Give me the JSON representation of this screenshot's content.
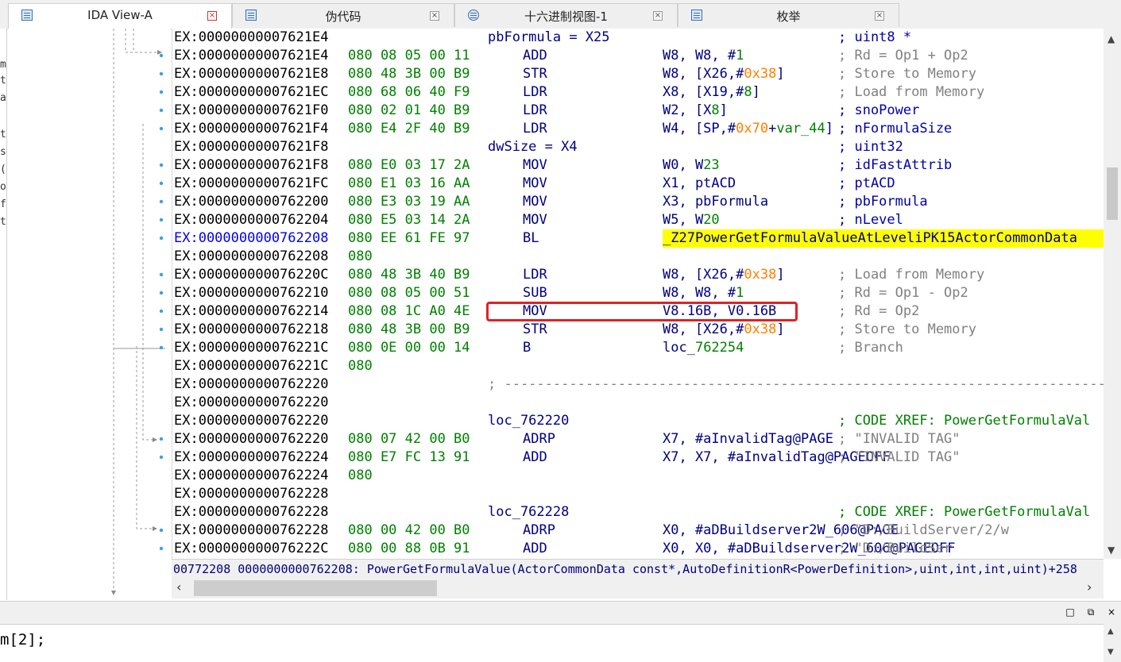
{
  "tabs": [
    {
      "label": "IDA View-A",
      "active": true
    },
    {
      "label": "伪代码",
      "active": false
    },
    {
      "label": "十六进制视图-1",
      "active": false
    },
    {
      "label": "枚举",
      "active": false
    }
  ],
  "left_panel_chars": [
    "m",
    "t",
    "a",
    "t",
    "s",
    "(",
    "o",
    "f",
    "t"
  ],
  "listing": [
    {
      "addr": "EX:00000000007621E4",
      "bytes": "",
      "mn": "pbFormula = X25",
      "op": "",
      "comment": "; uint8 *",
      "kind": "var"
    },
    {
      "addr": "EX:00000000007621E4",
      "bytes": "080 08 05 00 11",
      "mn": "ADD",
      "op": "W8, W8, #1",
      "comment": "; Rd = Op1 + Op2",
      "kind": "insn"
    },
    {
      "addr": "EX:00000000007621E8",
      "bytes": "080 48 3B 00 B9",
      "mn": "STR",
      "op": "W8, [X26,#0x38]",
      "comment": "; Store to Memory",
      "kind": "insn"
    },
    {
      "addr": "EX:00000000007621EC",
      "bytes": "080 68 06 40 F9",
      "mn": "LDR",
      "op": "X8, [X19,#8]",
      "comment": "; Load from Memory",
      "kind": "insn"
    },
    {
      "addr": "EX:00000000007621F0",
      "bytes": "080 02 01 40 B9",
      "mn": "LDR",
      "op": "W2, [X8]",
      "comment": "; snoPower",
      "kind": "insn",
      "nav": true
    },
    {
      "addr": "EX:00000000007621F4",
      "bytes": "080 E4 2F 40 B9",
      "mn": "LDR",
      "op": "W4, [SP,#0x70+var_44]",
      "comment": "; nFormulaSize",
      "kind": "insn",
      "nav": true
    },
    {
      "addr": "EX:00000000007621F8",
      "bytes": "",
      "mn": "dwSize = X4",
      "op": "",
      "comment": "; uint32",
      "kind": "var"
    },
    {
      "addr": "EX:00000000007621F8",
      "bytes": "080 E0 03 17 2A",
      "mn": "MOV",
      "op": "W0, W23",
      "comment": "; idFastAttrib",
      "kind": "insn",
      "nav": true
    },
    {
      "addr": "EX:00000000007621FC",
      "bytes": "080 E1 03 16 AA",
      "mn": "MOV",
      "op": "X1, ptACD",
      "comment": "; ptACD",
      "kind": "insn",
      "nav": true
    },
    {
      "addr": "EX:0000000000762200",
      "bytes": "080 E3 03 19 AA",
      "mn": "MOV",
      "op": "X3, pbFormula",
      "comment": "; pbFormula",
      "kind": "insn",
      "nav": true
    },
    {
      "addr": "EX:0000000000762204",
      "bytes": "080 E5 03 14 2A",
      "mn": "MOV",
      "op": "W5, W20",
      "comment": "; nLevel",
      "kind": "insn",
      "nav": true
    },
    {
      "addr": "EX:0000000000762208",
      "bytes": "080 EE 61 FE 97",
      "mn": "BL",
      "op": "_Z27PowerGetFormulaValueAtLeveliPK15ActorCommonData",
      "comment": "",
      "kind": "call",
      "blueaddr": true
    },
    {
      "addr": "EX:0000000000762208",
      "bytes": "080",
      "mn": "",
      "op": "",
      "comment": "",
      "kind": "blank"
    },
    {
      "addr": "EX:000000000076220C",
      "bytes": "080 48 3B 40 B9",
      "mn": "LDR",
      "op": "W8, [X26,#0x38]",
      "comment": "; Load from Memory",
      "kind": "insn"
    },
    {
      "addr": "EX:0000000000762210",
      "bytes": "080 08 05 00 51",
      "mn": "SUB",
      "op": "W8, W8, #1",
      "comment": "; Rd = Op1 - Op2",
      "kind": "insn"
    },
    {
      "addr": "EX:0000000000762214",
      "bytes": "080 08 1C A0 4E",
      "mn": "MOV",
      "op": "V8.16B, V0.16B",
      "comment": "; Rd = Op2",
      "kind": "insn",
      "boxed": true
    },
    {
      "addr": "EX:0000000000762218",
      "bytes": "080 48 3B 00 B9",
      "mn": "STR",
      "op": "W8, [X26,#0x38]",
      "comment": "; Store to Memory",
      "kind": "insn"
    },
    {
      "addr": "EX:000000000076221C",
      "bytes": "080 0E 00 00 14",
      "mn": "B",
      "op": "loc_762254",
      "comment": "; Branch",
      "kind": "insn"
    },
    {
      "addr": "EX:000000000076221C",
      "bytes": "080",
      "mn": "",
      "op": "",
      "comment": "",
      "kind": "blank"
    },
    {
      "addr": "EX:0000000000762220",
      "bytes": "",
      "mn": "; ---------------------------------------------------------------------------",
      "op": "",
      "comment": "",
      "kind": "sep"
    },
    {
      "addr": "EX:0000000000762220",
      "bytes": "",
      "mn": "",
      "op": "",
      "comment": "",
      "kind": "blank"
    },
    {
      "addr": "EX:0000000000762220",
      "bytes": "",
      "mn": "loc_762220",
      "op": "",
      "comment": "; CODE XREF: PowerGetFormulaVal",
      "kind": "label"
    },
    {
      "addr": "EX:0000000000762220",
      "bytes": "080 07 42 00 B0",
      "mn": "ADRP",
      "op": "X7, #aInvalidTag@PAGE",
      "comment": "; \"INVALID TAG\"",
      "kind": "insn"
    },
    {
      "addr": "EX:0000000000762224",
      "bytes": "080 E7 FC 13 91",
      "mn": "ADD",
      "op": "X7, X7, #aInvalidTag@PAGEOFF",
      "comment": "; \"INVALID TAG\"",
      "kind": "insn"
    },
    {
      "addr": "EX:0000000000762224",
      "bytes": "080",
      "mn": "",
      "op": "",
      "comment": "",
      "kind": "blank"
    },
    {
      "addr": "EX:0000000000762228",
      "bytes": "",
      "mn": "",
      "op": "",
      "comment": "",
      "kind": "blank"
    },
    {
      "addr": "EX:0000000000762228",
      "bytes": "",
      "mn": "loc_762228",
      "op": "",
      "comment": "; CODE XREF: PowerGetFormulaVal",
      "kind": "label"
    },
    {
      "addr": "EX:0000000000762228",
      "bytes": "080 00 42 00 B0",
      "mn": "ADRP",
      "op": "X0, #aDBuildserver2W_606@PAGE",
      "comment": "; \"D:/BuildServer/2/w",
      "kind": "insn"
    },
    {
      "addr": "EX:000000000076222C",
      "bytes": "080 00 88 0B 91",
      "mn": "ADD",
      "op": "X0, X0, #aDBuildserver2W_606@PAGEOFF",
      "comment": "; \"D:/BuildSer",
      "kind": "insn"
    }
  ],
  "status_line": "00772208 0000000000762208: PowerGetFormulaValue(ActorCommonData const*,AutoDefinitionR<PowerDefinition>,uint,int,int,uint)+258",
  "bottom_text": "m[2];",
  "icons": {
    "tab_icons": [
      "listing-view-icon",
      "pseudocode-icon",
      "hex-view-icon",
      "enum-icon"
    ],
    "tab_close": "close-icon"
  },
  "colors": {
    "highlight": "#ffff00",
    "redbox": "#e32020",
    "bytes": "#008000",
    "operand": "#000080",
    "comment": "#808080",
    "hex_immediate": "#ff8000"
  }
}
